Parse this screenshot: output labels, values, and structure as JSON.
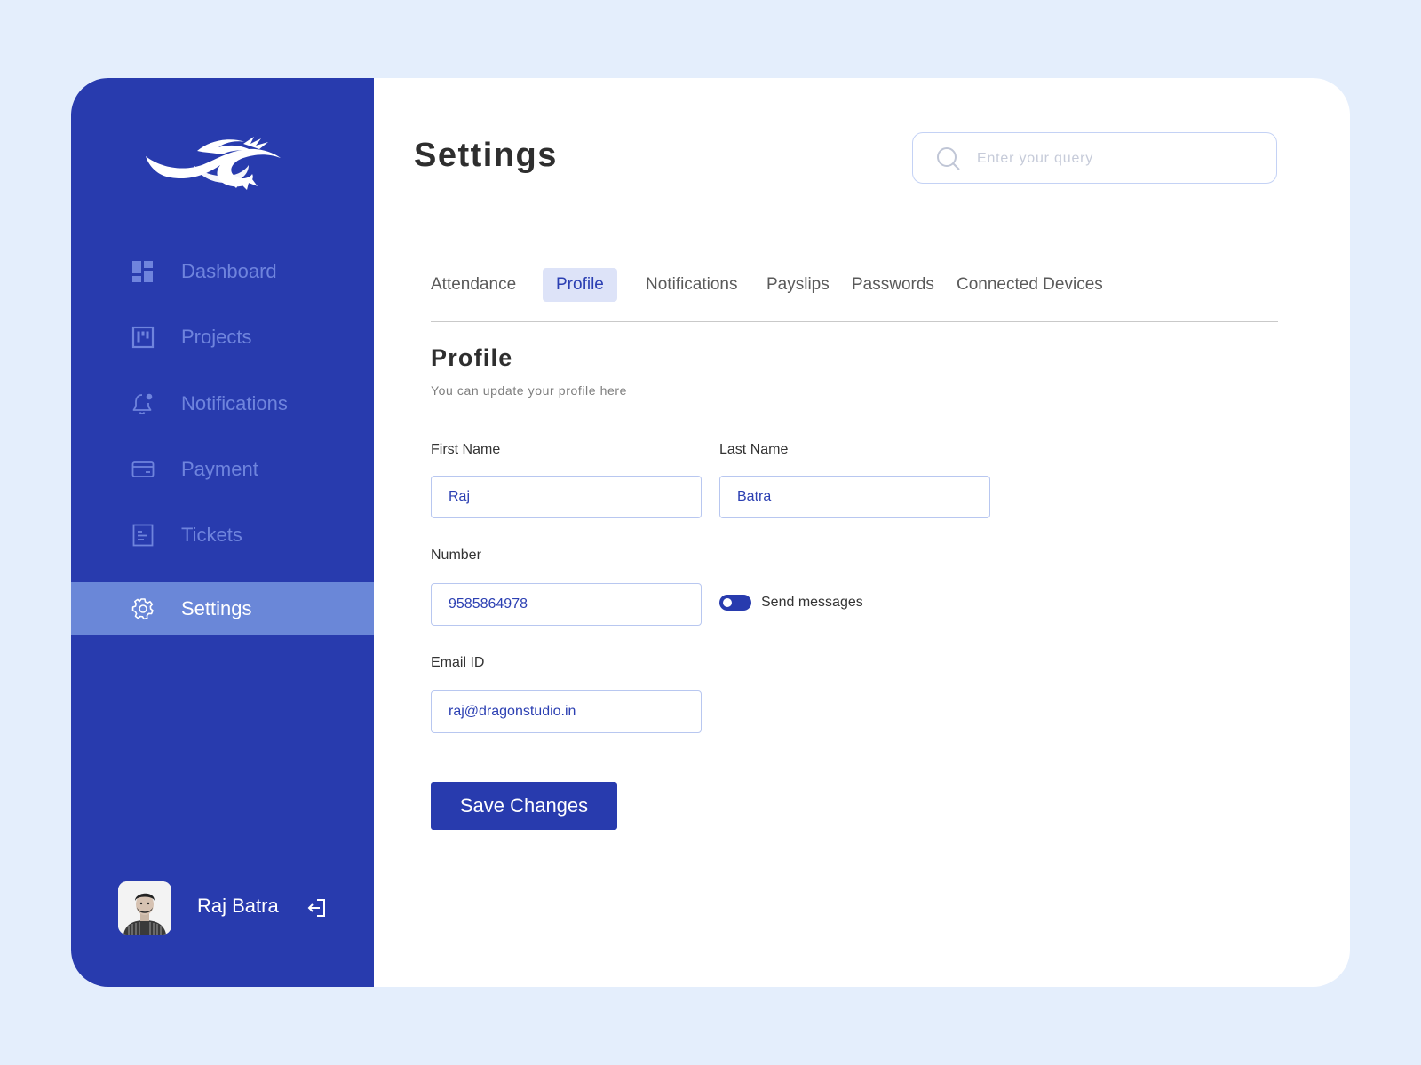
{
  "sidebar": {
    "logo_icon": "wave-dragon-logo",
    "items": [
      {
        "label": "Dashboard",
        "icon": "dashboard-icon",
        "active": false
      },
      {
        "label": "Projects",
        "icon": "projects-board-icon",
        "active": false
      },
      {
        "label": "Notifications",
        "icon": "bell-icon",
        "active": false
      },
      {
        "label": "Payment",
        "icon": "card-icon",
        "active": false
      },
      {
        "label": "Tickets",
        "icon": "ticket-document-icon",
        "active": false
      },
      {
        "label": "Settings",
        "icon": "gear-icon",
        "active": true
      }
    ],
    "user": {
      "name": "Raj Batra",
      "logout_icon": "logout-icon"
    }
  },
  "header": {
    "title": "Settings",
    "search": {
      "placeholder": "Enter your query",
      "value": ""
    }
  },
  "tabs": [
    {
      "label": "Attendance",
      "active": false
    },
    {
      "label": "Profile",
      "active": true
    },
    {
      "label": "Notifications",
      "active": false
    },
    {
      "label": "Payslips",
      "active": false
    },
    {
      "label": "Passwords",
      "active": false
    },
    {
      "label": "Connected Devices",
      "active": false
    }
  ],
  "profile": {
    "title": "Profile",
    "subtitle": "You can update your profile here",
    "first_name": {
      "label": "First Name",
      "value": "Raj"
    },
    "last_name": {
      "label": "Last Name",
      "value": "Batra"
    },
    "number": {
      "label": "Number",
      "value": "9585864978"
    },
    "send_messages": {
      "label": "Send messages",
      "enabled": true
    },
    "email": {
      "label": "Email ID",
      "value": "raj@dragonstudio.in"
    },
    "save_label": "Save Changes"
  },
  "colors": {
    "page_background": "#e4eefc",
    "sidebar": "#283bae",
    "sidebar_active": "#6a87d8",
    "sidebar_inactive_text": "#6f84dd",
    "accent": "#283bae",
    "active_tab_background": "#dde3f8",
    "input_border": "#b8c7f0"
  }
}
